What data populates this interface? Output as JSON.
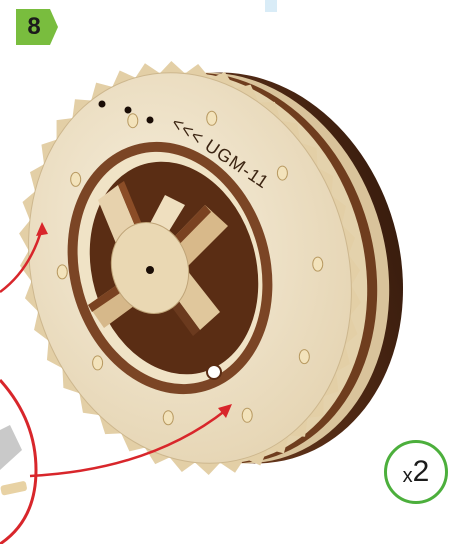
{
  "step": {
    "number": "8"
  },
  "quantity": {
    "prefix": "x",
    "count": "2"
  },
  "part": {
    "engraving": "<<< UGM-11"
  },
  "colors": {
    "step_badge_green": "#79bd3e",
    "quantity_ring_green": "#4caf3c",
    "arrow_red": "#d8262b",
    "plywood_face": "#efe4cc",
    "plywood_edge": "#6b3a1e"
  },
  "icons": [
    "step-badge-icon",
    "arrow-icon",
    "dowel-pin-icon",
    "gear-wheel-icon"
  ]
}
